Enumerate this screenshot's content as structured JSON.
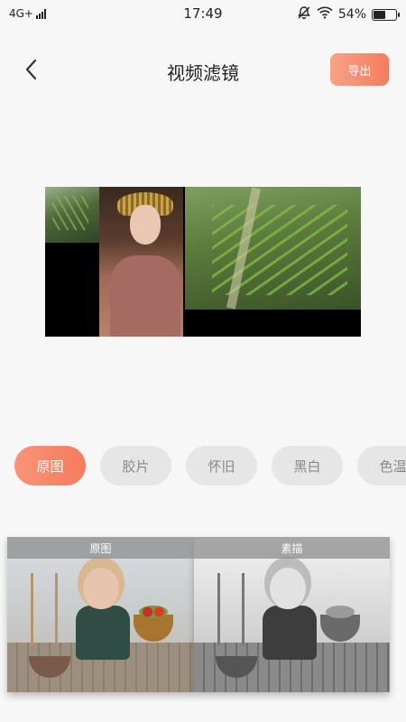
{
  "status_bar": {
    "network": "4G+",
    "time": "17:49",
    "battery": "54%",
    "battery_level": 0.54
  },
  "header": {
    "title": "视频滤镜",
    "export_label": "导出"
  },
  "filters": [
    {
      "label": "原图",
      "active": true
    },
    {
      "label": "胶片",
      "active": false
    },
    {
      "label": "怀旧",
      "active": false
    },
    {
      "label": "黑白",
      "active": false
    },
    {
      "label": "色温",
      "active": false
    }
  ],
  "thumbnails": [
    {
      "label": "原图",
      "style": "color"
    },
    {
      "label": "素描",
      "style": "sketch"
    }
  ],
  "colors": {
    "accent": "#f47c5f",
    "chip_inactive_bg": "#e6e6e6",
    "chip_inactive_text": "#888888",
    "background": "#f7f7f7"
  }
}
